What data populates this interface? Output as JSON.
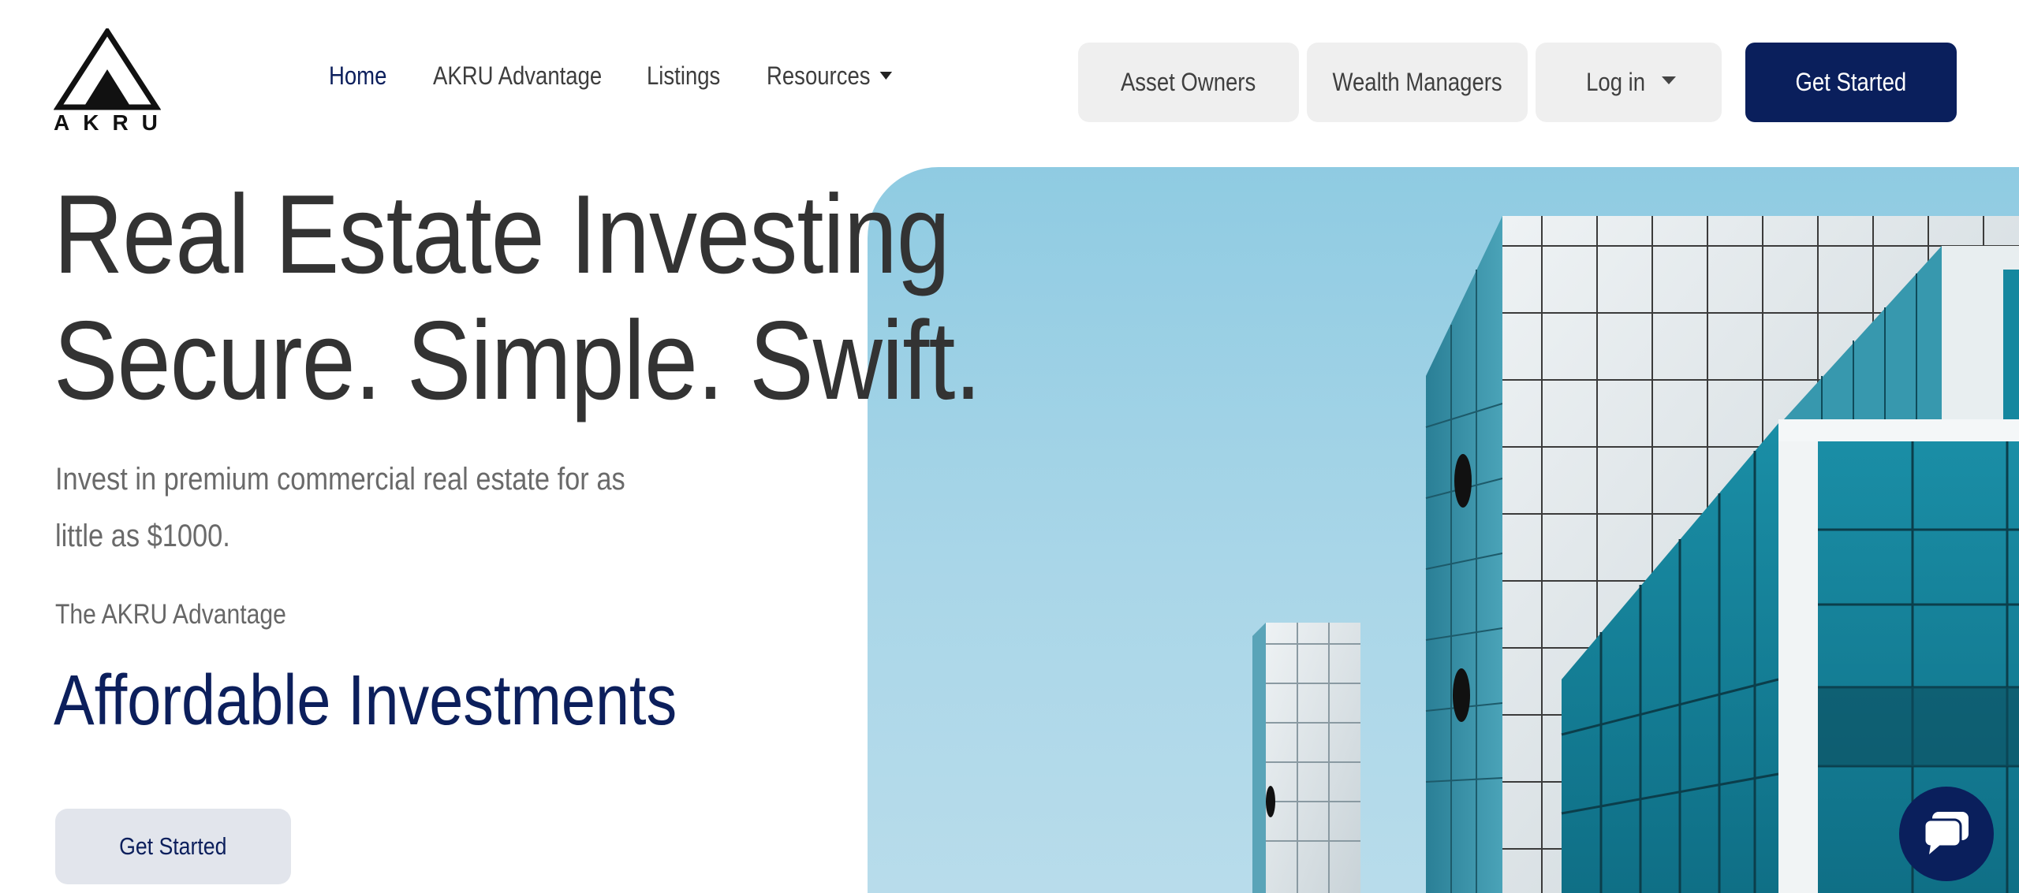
{
  "brand": {
    "logo_text": "AKRU"
  },
  "nav": {
    "items": [
      {
        "label": "Home",
        "active": true
      },
      {
        "label": "AKRU Advantage"
      },
      {
        "label": "Listings"
      },
      {
        "label": "Resources",
        "dropdown": true
      }
    ]
  },
  "header_actions": {
    "asset_owners": "Asset Owners",
    "wealth_managers": "Wealth Managers",
    "login": "Log in",
    "get_started": "Get Started"
  },
  "hero": {
    "title_line1": "Real Estate Investing",
    "title_line2": "Secure. Simple. Swift.",
    "subtitle_line1": "Invest in premium commercial real estate for as",
    "subtitle_line2": "little as $1000.",
    "advantage_label": "The AKRU Advantage",
    "advantage_title": "Affordable Investments",
    "cta_label": "Get Started"
  },
  "icons": {
    "logo": "akru-triangle-logo",
    "dropdown": "caret-down-icon",
    "chat": "chat-bubble-icon"
  },
  "colors": {
    "brand_navy": "#0a1f5c",
    "text_dark": "#333333",
    "text_muted": "#6a6a6a",
    "button_gray": "#efefef",
    "cta_gray": "#e2e5ec",
    "sky": "#9fd1e6"
  }
}
